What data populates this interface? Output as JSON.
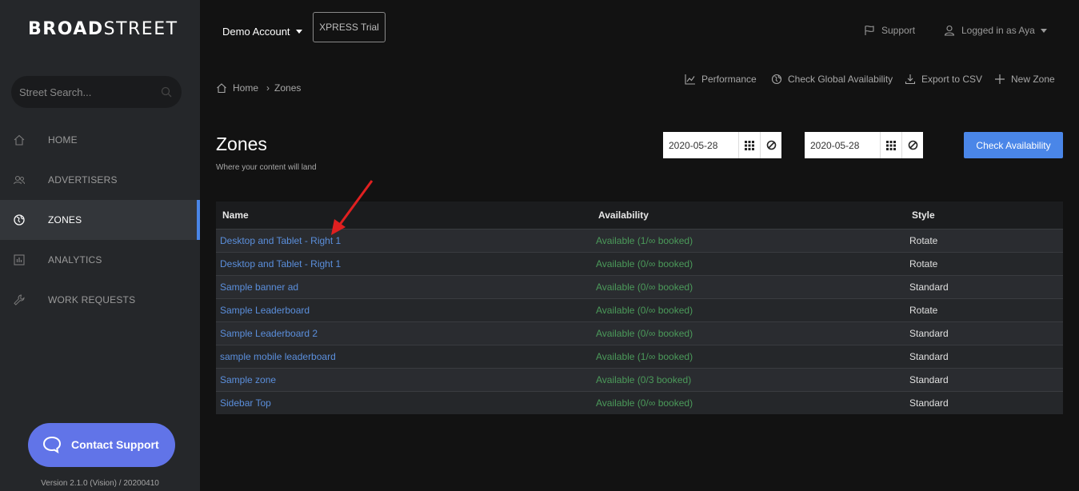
{
  "brand": {
    "logo_bold": "BROAD",
    "logo_light": "STREET"
  },
  "sidebar": {
    "search_placeholder": "Street Search...",
    "items": [
      {
        "label": "HOME",
        "icon": "home-icon"
      },
      {
        "label": "ADVERTISERS",
        "icon": "users-icon"
      },
      {
        "label": "ZONES",
        "icon": "globe-icon",
        "active": true
      },
      {
        "label": "ANALYTICS",
        "icon": "chart-icon"
      },
      {
        "label": "WORK REQUESTS",
        "icon": "wrench-icon"
      }
    ],
    "contact_label": "Contact Support",
    "version": "Version 2.1.0 (Vision) / 20200410"
  },
  "header": {
    "account": "Demo Account",
    "trial": "XPRESS Trial",
    "support": "Support",
    "user": "Logged in as Aya"
  },
  "breadcrumb": {
    "home": "Home",
    "current": "Zones"
  },
  "actions": {
    "performance": "Performance",
    "global": "Check Global Availability",
    "export": "Export to CSV",
    "new_zone": "New Zone"
  },
  "page": {
    "title": "Zones",
    "subtitle": "Where your content will land"
  },
  "dates": {
    "start": "2020-05-28",
    "end": "2020-05-28",
    "check_label": "Check Availability"
  },
  "table": {
    "headers": {
      "name": "Name",
      "availability": "Availability",
      "style": "Style"
    },
    "rows": [
      {
        "name": "Desktop and Tablet - Right 1",
        "availability": "Available (1/∞ booked)",
        "style": "Rotate"
      },
      {
        "name": "Desktop and Tablet - Right 1",
        "availability": "Available (0/∞ booked)",
        "style": "Rotate"
      },
      {
        "name": "Sample banner ad",
        "availability": "Available (0/∞ booked)",
        "style": "Standard"
      },
      {
        "name": "Sample Leaderboard",
        "availability": "Available (0/∞ booked)",
        "style": "Rotate"
      },
      {
        "name": "Sample Leaderboard 2",
        "availability": "Available (0/∞ booked)",
        "style": "Standard"
      },
      {
        "name": "sample mobile leaderboard",
        "availability": "Available (1/∞ booked)",
        "style": "Standard"
      },
      {
        "name": "Sample zone",
        "availability": "Available (0/3 booked)",
        "style": "Standard"
      },
      {
        "name": "Sidebar Top",
        "availability": "Available (0/∞ booked)",
        "style": "Standard"
      }
    ]
  },
  "colors": {
    "accent": "#4a86e8",
    "available": "#4b9a5a",
    "link": "#5b8fdc",
    "contact": "#6174e8",
    "annotation": "#e02020"
  }
}
